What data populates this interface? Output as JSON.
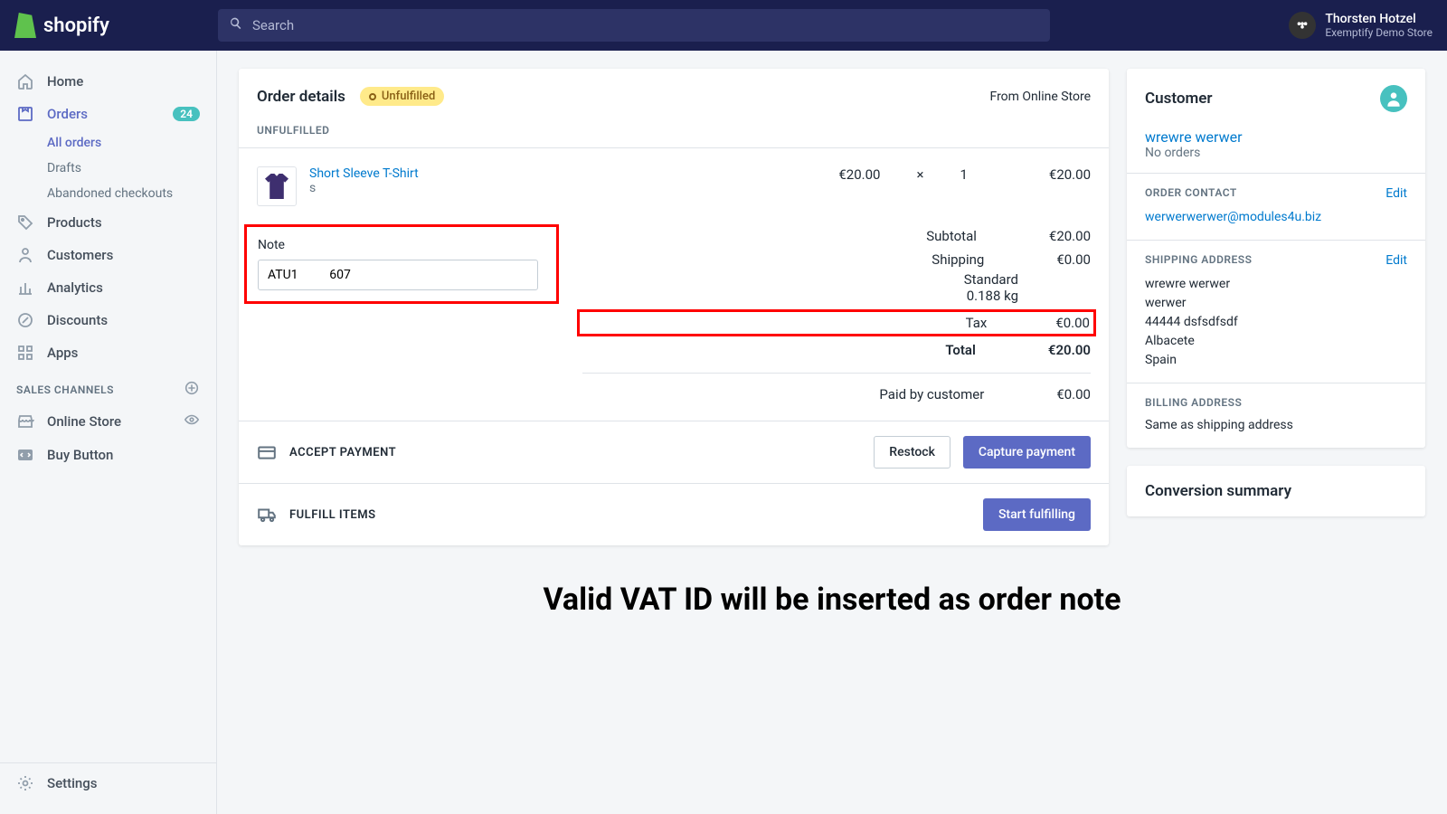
{
  "header": {
    "brand": "shopify",
    "search_placeholder": "Search",
    "user_name": "Thorsten Hotzel",
    "store_name": "Exemptify Demo Store"
  },
  "sidebar": {
    "home": "Home",
    "orders": "Orders",
    "orders_badge": "24",
    "sub_all_orders": "All orders",
    "sub_drafts": "Drafts",
    "sub_abandoned": "Abandoned checkouts",
    "products": "Products",
    "customers": "Customers",
    "analytics": "Analytics",
    "discounts": "Discounts",
    "apps": "Apps",
    "sales_channels": "SALES CHANNELS",
    "online_store": "Online Store",
    "buy_button": "Buy Button",
    "settings": "Settings"
  },
  "order": {
    "title": "Order details",
    "status": "Unfulfilled",
    "from_label": "From ",
    "from_source": "Online Store",
    "section_unfulfilled": "UNFULFILLED",
    "product_name": "Short Sleeve T-Shirt",
    "product_variant": "s",
    "unit_price": "€20.00",
    "qty_sep": "×",
    "qty": "1",
    "line_total": "€20.00",
    "note_label": "Note",
    "note_value": "ATU1          607",
    "subtotal_label": "Subtotal",
    "subtotal_value": "€20.00",
    "shipping_label": "Shipping",
    "shipping_method": "Standard",
    "shipping_weight": "0.188 kg",
    "shipping_value": "€0.00",
    "tax_label": "Tax",
    "tax_value": "€0.00",
    "total_label": "Total",
    "total_value": "€20.00",
    "paid_label": "Paid by customer",
    "paid_value": "€0.00",
    "accept_payment": "ACCEPT PAYMENT",
    "restock": "Restock",
    "capture_payment": "Capture payment",
    "fulfill_items": "FULFILL ITEMS",
    "start_fulfilling": "Start fulfilling"
  },
  "customer": {
    "title": "Customer",
    "name": "wrewre werwer",
    "orders": "No orders",
    "contact_label": "ORDER CONTACT",
    "edit": "Edit",
    "email": "werwerwerwer@modules4u.biz",
    "shipping_label": "SHIPPING ADDRESS",
    "ship_line1": "wrewre werwer",
    "ship_line2": "werwer",
    "ship_line3": "44444 dsfsdfsdf",
    "ship_line4": "Albacete",
    "ship_line5": "Spain",
    "billing_label": "BILLING ADDRESS",
    "billing_text": "Same as shipping address",
    "conversion_title": "Conversion summary"
  },
  "caption": "Valid VAT ID will be inserted as order note"
}
